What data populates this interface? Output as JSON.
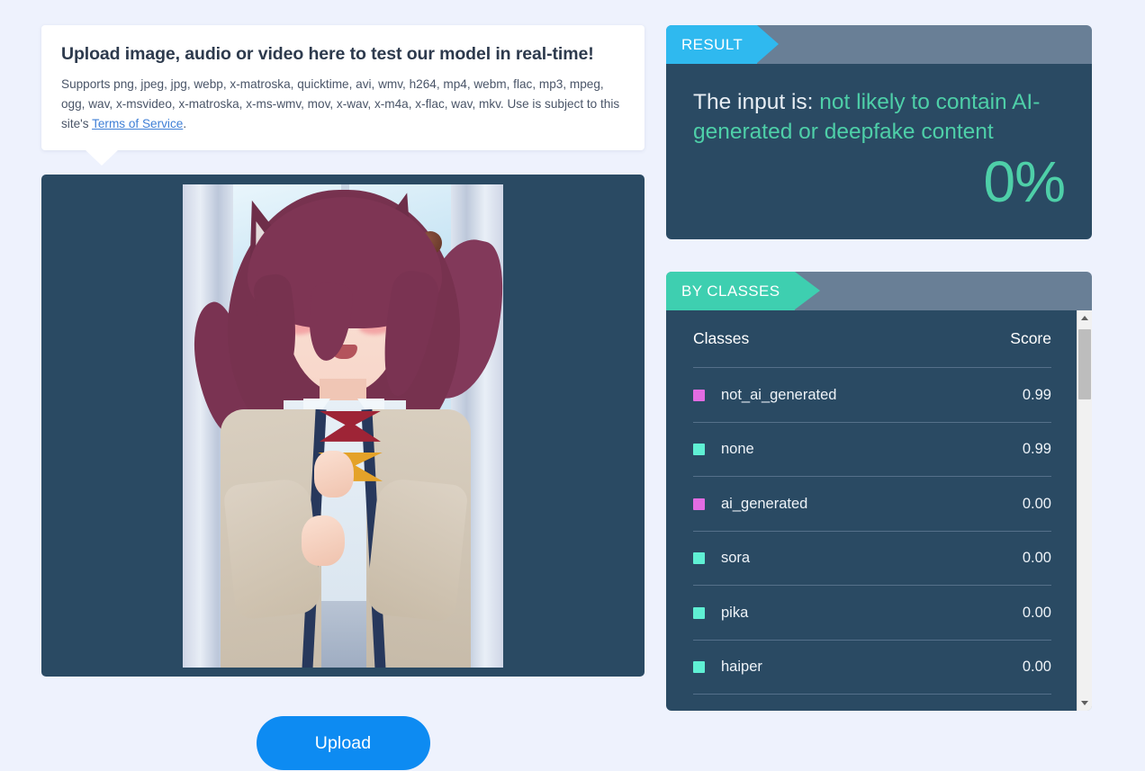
{
  "upload_card": {
    "title": "Upload image, audio or video here to test our model in real-time!",
    "description_before": "Supports png, jpeg, jpg, webp, x-matroska, quicktime, avi, wmv, h264, mp4, webm, flac, mp3, mpeg, ogg, wav, x-msvideo, x-matroska, x-ms-wmv, mov, x-wav, x-m4a, x-flac, wav, mkv. Use is subject to this site's ",
    "terms_link": "Terms of Service",
    "description_after": "."
  },
  "preview": {
    "alt": "anime illustration of a cat-eared character in a school uniform"
  },
  "upload_button": {
    "label": "Upload"
  },
  "result_panel": {
    "tab_label": "RESULT",
    "prefix": "The input is: ",
    "verdict": "not likely to contain AI-generated or deepfake content",
    "percentage": "0%",
    "accent_color": "#4ecfa8",
    "tab_color": "#2fb9ef"
  },
  "classes_panel": {
    "tab_label": "BY CLASSES",
    "tab_color": "#3ecfb0",
    "columns": {
      "name": "Classes",
      "score": "Score"
    },
    "rows": [
      {
        "name": "not_ai_generated",
        "score": "0.99",
        "color": "#e26ce2"
      },
      {
        "name": "none",
        "score": "0.99",
        "color": "#5ff0d4"
      },
      {
        "name": "ai_generated",
        "score": "0.00",
        "color": "#e26ce2"
      },
      {
        "name": "sora",
        "score": "0.00",
        "color": "#5ff0d4"
      },
      {
        "name": "pika",
        "score": "0.00",
        "color": "#5ff0d4"
      },
      {
        "name": "haiper",
        "score": "0.00",
        "color": "#5ff0d4"
      }
    ],
    "scrollbar": {
      "up_arrow": "scroll-up",
      "down_arrow": "scroll-down"
    }
  },
  "theme": {
    "page_background": "#eef2fd",
    "panel_background": "#2a4a63",
    "panel_header": "#697f96",
    "link_color": "#3f7fd6",
    "button_color": "#0d8bf2"
  }
}
